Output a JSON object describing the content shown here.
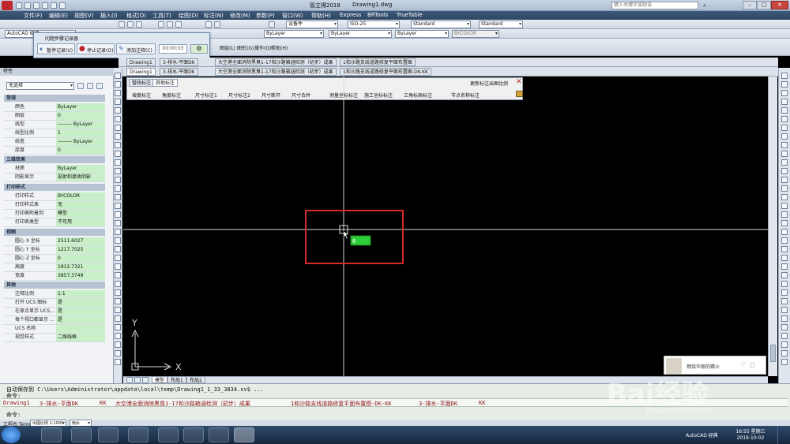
{
  "window": {
    "title": "管立得2018",
    "document": "Drawing1.dwg",
    "search_placeholder": "键入关键字或短语"
  },
  "menu": {
    "items": [
      "文件(F)",
      "编辑(E)",
      "视图(V)",
      "插入(I)",
      "格式(O)",
      "工具(T)",
      "绘图(D)",
      "标注(N)",
      "修改(M)",
      "参数(P)",
      "窗口(W)",
      "帮助(H)",
      "Express",
      "BRTools",
      "TrueTable"
    ]
  },
  "toolbar": {
    "workspace": "AutoCAD 经典",
    "dim_style": "设备件",
    "scale": "ISO-25",
    "text_style": "Standard",
    "table_style": "Standard",
    "layer_color": "ByLayer",
    "linetype": "ByLayer",
    "lineweight": "ByLayer",
    "plot_style": "BYCOLOR"
  },
  "step_recorder": {
    "title": "问题步骤记录器",
    "pause": "暂停记录(U)",
    "stop": "停止记录(O)",
    "comment": "添加注释(C)",
    "timer": "00:00:03"
  },
  "secondary_menu": [
    "图层(L)",
    "图形(G)",
    "操作(O)",
    "帮助(H)"
  ],
  "doc_tabs": [
    "Drawing1",
    "3-排水-平面DK",
    "大空港全面消除黑臭1-17和沙路箱涵检测（初步）成果",
    "1和沙路支线道路修复平面布置图-DK-KK"
  ],
  "doc_tabs_row1": [
    "Drawing1",
    "3-排水-平面DK",
    "大空港全面消除黑臭1-17和沙路箱涵检测（初步）成果",
    "1和沙路支线道路修复平面布置图"
  ],
  "properties": {
    "title": "特性",
    "selection": "无选择",
    "sections": {
      "general": "常规",
      "threed": "三维效果",
      "print": "打印样式",
      "view": "视图",
      "misc": "其他"
    },
    "general_rows": [
      {
        "k": "颜色",
        "v": "ByLayer"
      },
      {
        "k": "图层",
        "v": "0"
      },
      {
        "k": "线型",
        "v": "——— ByLayer"
      },
      {
        "k": "线型比例",
        "v": "1"
      },
      {
        "k": "线宽",
        "v": "——— ByLayer"
      },
      {
        "k": "厚度",
        "v": "0"
      }
    ],
    "threed_rows": [
      {
        "k": "材质",
        "v": "ByLayer"
      },
      {
        "k": "阴影显示",
        "v": "投射和接收阴影"
      }
    ],
    "print_rows": [
      {
        "k": "打印样式",
        "v": "BYCOLOR"
      },
      {
        "k": "打印样式表",
        "v": "无"
      },
      {
        "k": "打印表附着到",
        "v": "模型"
      },
      {
        "k": "打印表类型",
        "v": "不可用"
      }
    ],
    "view_rows": [
      {
        "k": "圆心 X 坐标",
        "v": "2511.6027"
      },
      {
        "k": "圆心 Y 坐标",
        "v": "1217.7025"
      },
      {
        "k": "圆心 Z 坐标",
        "v": "0"
      },
      {
        "k": "高度",
        "v": "1812.7321"
      },
      {
        "k": "宽度",
        "v": "3857.3749"
      }
    ],
    "misc_rows": [
      {
        "k": "注释比例",
        "v": "1:1"
      },
      {
        "k": "打开 UCS 图标",
        "v": "是"
      },
      {
        "k": "在原点显示 UCS...",
        "v": "是"
      },
      {
        "k": "每个视口都显示 ...",
        "v": "是"
      },
      {
        "k": "UCS 名称",
        "v": ""
      },
      {
        "k": "视觉样式",
        "v": "二维线框"
      }
    ]
  },
  "dim_panel": {
    "tabs": [
      "管线标注",
      "其他标注"
    ],
    "link": "更新标注出图比例",
    "buttons": [
      "坡度标注",
      "角度标注",
      "尺寸标注1",
      "尺寸标注2",
      "尺寸断开",
      "尺寸合并",
      "测量坐标标注",
      "施工坐标标注",
      "三角标高标注",
      "节点名称标注"
    ]
  },
  "canvas": {
    "ucs_x": "X",
    "ucs_y": "Y",
    "layout_tabs": [
      "模型",
      "布局1",
      "布局2"
    ],
    "cursor_tooltip": "6"
  },
  "command": {
    "line1": "自动保存到 C:\\Users\\Administrator\\appdata\\local\\temp\\Drawing1_1_33_3834.sv$ ...",
    "line2": "命令:",
    "line3": "命令:"
  },
  "bottom_tabs": [
    "Drawing1",
    "3-排水-平面DK",
    "KK",
    "大空港全面消除黑臭1-17和沙路箱涵检测（初步）成果",
    "1和沙路支线道路修复平面布置图-DK-KK",
    "3-排水-平面DK",
    "KK"
  ],
  "status": {
    "project": "工程名:Temp",
    "scale_label": "出图比例 1:1000",
    "mode": "雨水"
  },
  "notification": {
    "text": "燃烧华丽的蜡火"
  },
  "taskbar": {
    "time": "16:55 星期三",
    "date": "2019-10-02",
    "tray": "AutoCAD 经典"
  },
  "watermark": {
    "brand": "Bai经验",
    "url": "jingyan.baidu.com"
  }
}
